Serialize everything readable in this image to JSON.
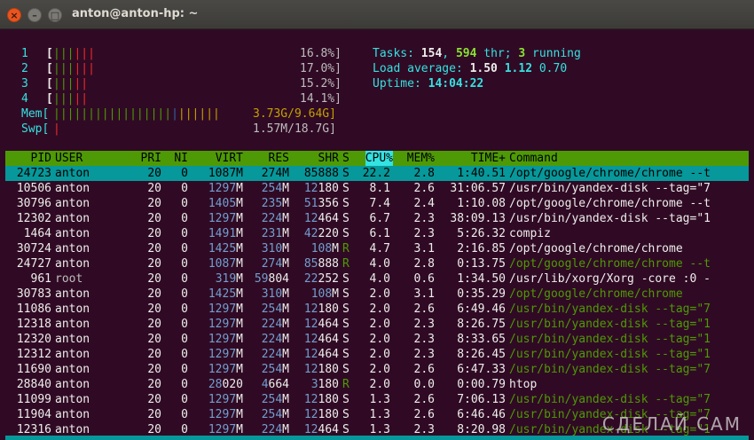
{
  "window": {
    "title": "anton@anton-hp: ~",
    "close": "×",
    "minimize": "–",
    "maximize": "□"
  },
  "meters": {
    "cpus": [
      {
        "label": "1",
        "bars": "||||||",
        "value": "16.8%]"
      },
      {
        "label": "2",
        "bars": "||||||",
        "value": "17.0%]"
      },
      {
        "label": "3",
        "bars": "|||||",
        "value": "15.2%]"
      },
      {
        "label": "4",
        "bars": "|||||",
        "value": "14.1%]"
      }
    ],
    "mem": {
      "label": "Mem[",
      "bars": "||||||||||||||||||||||||",
      "value": "3.73G/9.64G]"
    },
    "swp": {
      "label": "Swp[",
      "bars": "|",
      "value": "1.57M/18.7G]"
    }
  },
  "stats": {
    "tasks_label": "Tasks: ",
    "tasks": "154",
    "tasks_sep": ", ",
    "threads": "594",
    "thr_label": " thr; ",
    "running": "3",
    "running_label": " running",
    "load_label": "Load average: ",
    "load1": "1.50",
    "load5": "1.12",
    "load15": "0.70",
    "uptime_label": "Uptime: ",
    "uptime": "14:04:22"
  },
  "columns": [
    "PID",
    "USER",
    "PRI",
    "NI",
    "VIRT",
    "RES",
    "SHR",
    "S",
    "CPU%",
    "MEM%",
    "TIME+",
    "Command"
  ],
  "processes": [
    {
      "pid": "24723",
      "user": "anton",
      "pri": "20",
      "ni": "0",
      "virt": "1087M",
      "res": "274M",
      "shr": "85888",
      "s": "S",
      "cpu": "22.2",
      "mem": "2.8",
      "time": "1:40.51",
      "cmd": "/opt/google/chrome/chrome --t"
    },
    {
      "pid": "10506",
      "user": "anton",
      "pri": "20",
      "ni": "0",
      "virt": "1297M",
      "res": "254M",
      "shr": "12180",
      "s": "S",
      "cpu": "8.1",
      "mem": "2.6",
      "time": "31:06.57",
      "cmd": "/usr/bin/yandex-disk --tag=\"7"
    },
    {
      "pid": "30796",
      "user": "anton",
      "pri": "20",
      "ni": "0",
      "virt": "1405M",
      "res": "235M",
      "shr": "51356",
      "s": "S",
      "cpu": "7.4",
      "mem": "2.4",
      "time": "1:10.08",
      "cmd": "/opt/google/chrome/chrome --t"
    },
    {
      "pid": "12302",
      "user": "anton",
      "pri": "20",
      "ni": "0",
      "virt": "1297M",
      "res": "224M",
      "shr": "12464",
      "s": "S",
      "cpu": "6.7",
      "mem": "2.3",
      "time": "38:09.13",
      "cmd": "/usr/bin/yandex-disk --tag=\"1"
    },
    {
      "pid": "1464",
      "user": "anton",
      "pri": "20",
      "ni": "0",
      "virt": "1491M",
      "res": "231M",
      "shr": "42220",
      "s": "S",
      "cpu": "6.1",
      "mem": "2.3",
      "time": "5:26.32",
      "cmd": "compiz"
    },
    {
      "pid": "30724",
      "user": "anton",
      "pri": "20",
      "ni": "0",
      "virt": "1425M",
      "res": "310M",
      "shr": "108M",
      "s": "R",
      "cpu": "4.7",
      "mem": "3.1",
      "time": "2:16.85",
      "cmd": "/opt/google/chrome/chrome"
    },
    {
      "pid": "24727",
      "user": "anton",
      "pri": "20",
      "ni": "0",
      "virt": "1087M",
      "res": "274M",
      "shr": "85888",
      "s": "R",
      "cpu": "4.0",
      "mem": "2.8",
      "time": "0:13.75",
      "cmd": "/opt/google/chrome/chrome --t"
    },
    {
      "pid": "961",
      "user": "root",
      "pri": "20",
      "ni": "0",
      "virt": "319M",
      "res": "59804",
      "shr": "22252",
      "s": "S",
      "cpu": "4.0",
      "mem": "0.6",
      "time": "1:34.50",
      "cmd": "/usr/lib/xorg/Xorg -core :0 -"
    },
    {
      "pid": "30783",
      "user": "anton",
      "pri": "20",
      "ni": "0",
      "virt": "1425M",
      "res": "310M",
      "shr": "108M",
      "s": "S",
      "cpu": "2.0",
      "mem": "3.1",
      "time": "0:35.29",
      "cmd": "/opt/google/chrome/chrome"
    },
    {
      "pid": "11086",
      "user": "anton",
      "pri": "20",
      "ni": "0",
      "virt": "1297M",
      "res": "254M",
      "shr": "12180",
      "s": "S",
      "cpu": "2.0",
      "mem": "2.6",
      "time": "6:49.46",
      "cmd": "/usr/bin/yandex-disk --tag=\"7"
    },
    {
      "pid": "12318",
      "user": "anton",
      "pri": "20",
      "ni": "0",
      "virt": "1297M",
      "res": "224M",
      "shr": "12464",
      "s": "S",
      "cpu": "2.0",
      "mem": "2.3",
      "time": "8:26.75",
      "cmd": "/usr/bin/yandex-disk --tag=\"1"
    },
    {
      "pid": "12320",
      "user": "anton",
      "pri": "20",
      "ni": "0",
      "virt": "1297M",
      "res": "224M",
      "shr": "12464",
      "s": "S",
      "cpu": "2.0",
      "mem": "2.3",
      "time": "8:33.65",
      "cmd": "/usr/bin/yandex-disk --tag=\"1"
    },
    {
      "pid": "12312",
      "user": "anton",
      "pri": "20",
      "ni": "0",
      "virt": "1297M",
      "res": "224M",
      "shr": "12464",
      "s": "S",
      "cpu": "2.0",
      "mem": "2.3",
      "time": "8:26.45",
      "cmd": "/usr/bin/yandex-disk --tag=\"1"
    },
    {
      "pid": "11690",
      "user": "anton",
      "pri": "20",
      "ni": "0",
      "virt": "1297M",
      "res": "254M",
      "shr": "12180",
      "s": "S",
      "cpu": "2.0",
      "mem": "2.6",
      "time": "6:47.33",
      "cmd": "/usr/bin/yandex-disk --tag=\"7"
    },
    {
      "pid": "28840",
      "user": "anton",
      "pri": "20",
      "ni": "0",
      "virt": "28020",
      "res": "4664",
      "shr": "3180",
      "s": "R",
      "cpu": "2.0",
      "mem": "0.0",
      "time": "0:00.79",
      "cmd": "htop"
    },
    {
      "pid": "11099",
      "user": "anton",
      "pri": "20",
      "ni": "0",
      "virt": "1297M",
      "res": "254M",
      "shr": "12180",
      "s": "S",
      "cpu": "1.3",
      "mem": "2.6",
      "time": "7:06.13",
      "cmd": "/usr/bin/yandex-disk --tag=\"7"
    },
    {
      "pid": "11904",
      "user": "anton",
      "pri": "20",
      "ni": "0",
      "virt": "1297M",
      "res": "254M",
      "shr": "12180",
      "s": "S",
      "cpu": "1.3",
      "mem": "2.6",
      "time": "6:46.46",
      "cmd": "/usr/bin/yandex-disk --tag=\"7"
    },
    {
      "pid": "12316",
      "user": "anton",
      "pri": "20",
      "ni": "0",
      "virt": "1297M",
      "res": "224M",
      "shr": "12464",
      "s": "S",
      "cpu": "1.3",
      "mem": "2.3",
      "time": "8:20.98",
      "cmd": "/usr/bin/yandex-disk --tag=\"1"
    }
  ],
  "watermark": "СДЕЛАЙ САМ",
  "colors": {
    "background": "#300a24",
    "header": "#4e9a06",
    "selected": "#06989a",
    "cyan": "#34e2e2",
    "green": "#8ae234"
  }
}
